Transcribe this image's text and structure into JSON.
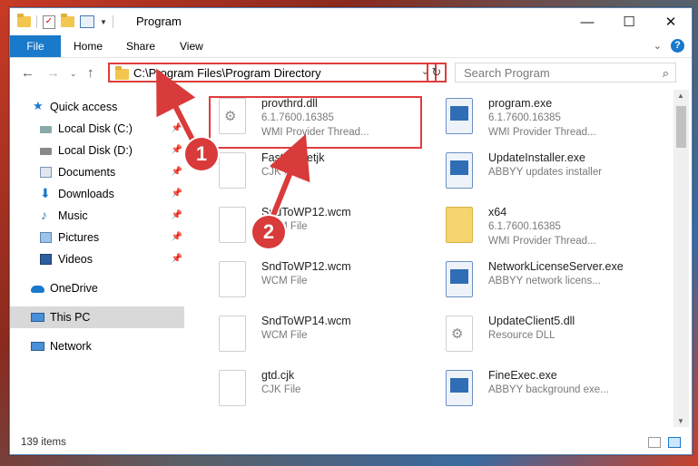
{
  "window": {
    "title": "Program",
    "minimize_icon": "minimize-icon",
    "maximize_icon": "maximize-icon",
    "close_icon": "close-icon"
  },
  "ribbon": {
    "tabs": [
      "File",
      "Home",
      "Share",
      "View"
    ]
  },
  "address": {
    "path": "C:\\Program Files\\Program Directory",
    "search_placeholder": "Search Program"
  },
  "sidebar": {
    "items": [
      {
        "label": "Quick access",
        "icon": "star-icon",
        "pinned": false
      },
      {
        "label": "Local Disk (C:)",
        "icon": "drive-icon",
        "pinned": true
      },
      {
        "label": "Local Disk (D:)",
        "icon": "drive-icon",
        "pinned": true
      },
      {
        "label": "Documents",
        "icon": "documents-icon",
        "pinned": true
      },
      {
        "label": "Downloads",
        "icon": "download-icon",
        "pinned": true
      },
      {
        "label": "Music",
        "icon": "music-icon",
        "pinned": true
      },
      {
        "label": "Pictures",
        "icon": "pictures-icon",
        "pinned": true
      },
      {
        "label": "Videos",
        "icon": "videos-icon",
        "pinned": true
      },
      {
        "label": "OneDrive",
        "icon": "cloud-icon",
        "pinned": false
      },
      {
        "label": "This PC",
        "icon": "computer-icon",
        "pinned": false
      },
      {
        "label": "Network",
        "icon": "network-icon",
        "pinned": false
      }
    ]
  },
  "files": [
    {
      "name": "provthrd.dll",
      "meta1": "6.1.7600.16385",
      "meta2": "WMI Provider Thread...",
      "type": "gear"
    },
    {
      "name": "program.exe",
      "meta1": "6.1.7600.16385",
      "meta2": "WMI Provider Thread...",
      "type": "exe"
    },
    {
      "name": "FastPicSetjk",
      "meta1": "CJK File",
      "meta2": "",
      "type": "blank"
    },
    {
      "name": "UpdateInstaller.exe",
      "meta1": "ABBYY updates installer",
      "meta2": "",
      "type": "exe"
    },
    {
      "name": "SndToWP12.wcm",
      "meta1": "WCM File",
      "meta2": "",
      "type": "blank"
    },
    {
      "name": "x64",
      "meta1": "6.1.7600.16385",
      "meta2": "WMI Provider Thread...",
      "type": "folder"
    },
    {
      "name": "SndToWP12.wcm",
      "meta1": "WCM File",
      "meta2": "",
      "type": "blank"
    },
    {
      "name": "NetworkLicenseServer.exe",
      "meta1": "ABBYY network licens...",
      "meta2": "",
      "type": "exe"
    },
    {
      "name": "SndToWP14.wcm",
      "meta1": "WCM File",
      "meta2": "",
      "type": "blank"
    },
    {
      "name": "UpdateClient5.dll",
      "meta1": "Resource DLL",
      "meta2": "",
      "type": "gear"
    },
    {
      "name": "gtd.cjk",
      "meta1": "CJK File",
      "meta2": "",
      "type": "blank"
    },
    {
      "name": "FineExec.exe",
      "meta1": "ABBYY background exe...",
      "meta2": "",
      "type": "exe"
    }
  ],
  "status": {
    "item_count": "139 items"
  },
  "annotations": {
    "step1": "1",
    "step2": "2",
    "color": "#d93a3a"
  }
}
